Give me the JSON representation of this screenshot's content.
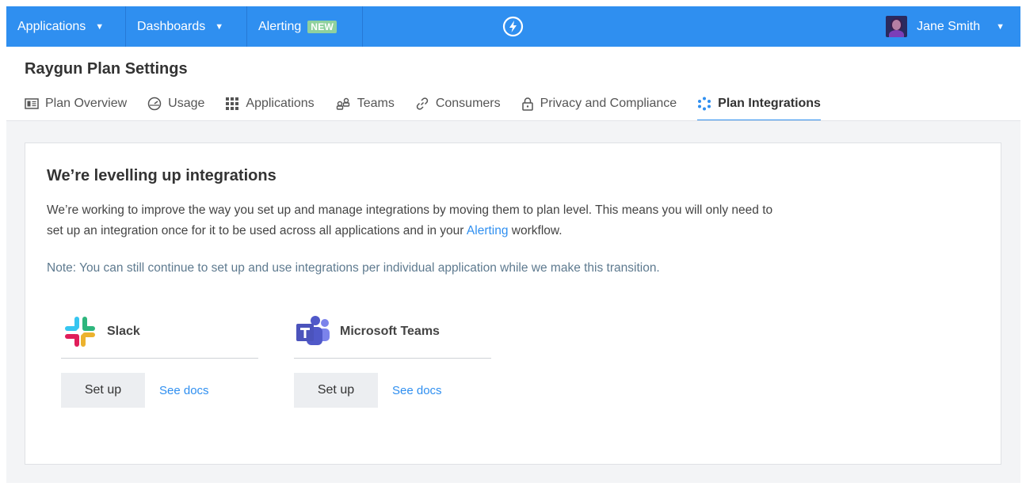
{
  "topbar": {
    "applications_label": "Applications",
    "dashboards_label": "Dashboards",
    "alerting_label": "Alerting",
    "alerting_badge": "NEW",
    "user_name": "Jane Smith",
    "bar_color": "#2f8ff0"
  },
  "page": {
    "title": "Raygun Plan Settings"
  },
  "tabs": [
    {
      "label": "Plan Overview",
      "icon": "overview-icon"
    },
    {
      "label": "Usage",
      "icon": "gauge-icon"
    },
    {
      "label": "Applications",
      "icon": "grid-icon"
    },
    {
      "label": "Teams",
      "icon": "teams-icon"
    },
    {
      "label": "Consumers",
      "icon": "link-icon"
    },
    {
      "label": "Privacy and Compliance",
      "icon": "lock-icon"
    },
    {
      "label": "Plan Integrations",
      "icon": "integrations-icon",
      "active": true
    }
  ],
  "panel": {
    "title": "We’re levelling up integrations",
    "body_part1": "We’re working to improve the way you set up and manage integrations by moving them to plan level. This means you will only need to set up an integration once for it to be used across all applications and in your ",
    "body_link": "Alerting",
    "body_part2": " workflow.",
    "note": "Note: You can still continue to set up and use integrations per individual application while we make this transition."
  },
  "integrations": [
    {
      "name": "Slack",
      "setup_label": "Set up",
      "docs_label": "See docs",
      "icon": "slack-icon"
    },
    {
      "name": "Microsoft Teams",
      "setup_label": "Set up",
      "docs_label": "See docs",
      "icon": "microsoft-teams-icon"
    }
  ]
}
